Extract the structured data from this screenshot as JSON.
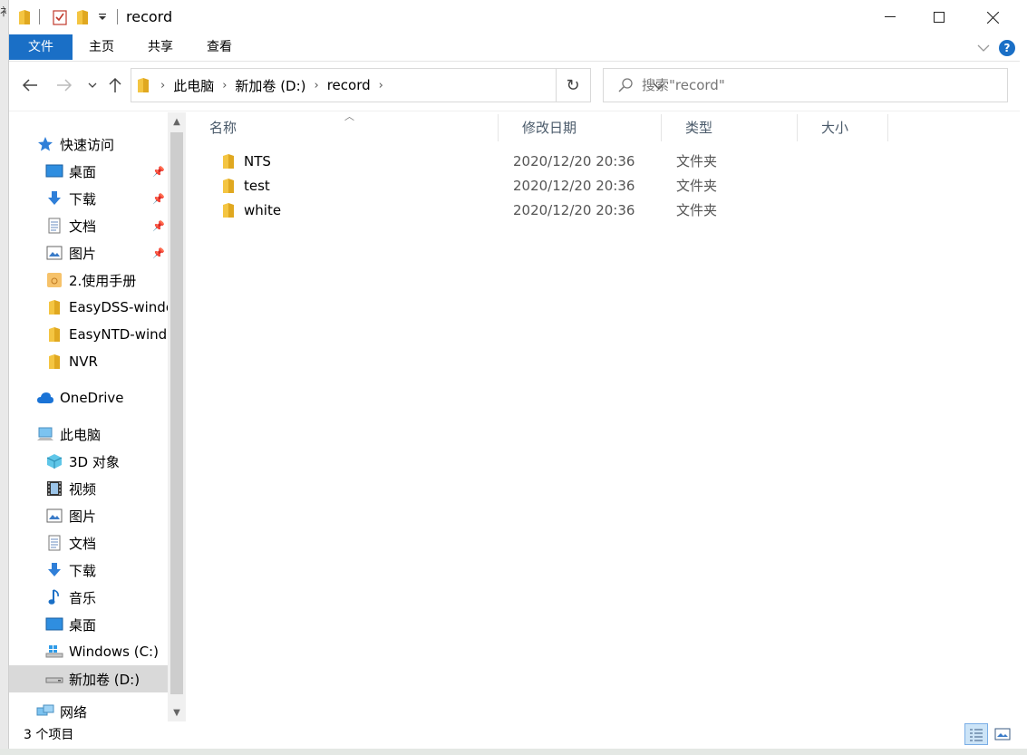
{
  "window": {
    "title": "record",
    "left_edge_text": "衤"
  },
  "ribbon": {
    "tabs": [
      {
        "label": "文件"
      },
      {
        "label": "主页"
      },
      {
        "label": "共享"
      },
      {
        "label": "查看"
      }
    ],
    "help": "?"
  },
  "address": {
    "crumbs": [
      "此电脑",
      "新加卷 (D:)",
      "record"
    ]
  },
  "search": {
    "placeholder": "搜索\"record\""
  },
  "nav": {
    "quick_access": "快速访问",
    "quick_items": [
      {
        "label": "桌面",
        "icon": "desktop-icon"
      },
      {
        "label": "下载",
        "icon": "download-icon"
      },
      {
        "label": "文档",
        "icon": "document-icon"
      },
      {
        "label": "图片",
        "icon": "picture-icon"
      },
      {
        "label": "2.使用手册",
        "icon": "folder-icon"
      },
      {
        "label": "EasyDSS-windo",
        "icon": "folder-icon"
      },
      {
        "label": "EasyNTD-windo",
        "icon": "folder-icon"
      },
      {
        "label": "NVR",
        "icon": "folder-icon"
      }
    ],
    "onedrive": "OneDrive",
    "this_pc": "此电脑",
    "pc_items": [
      {
        "label": "3D 对象",
        "icon": "3d-objects-icon"
      },
      {
        "label": "视频",
        "icon": "video-icon"
      },
      {
        "label": "图片",
        "icon": "picture-icon"
      },
      {
        "label": "文档",
        "icon": "document-icon"
      },
      {
        "label": "下载",
        "icon": "download-icon"
      },
      {
        "label": "音乐",
        "icon": "music-icon"
      },
      {
        "label": "桌面",
        "icon": "desktop-icon"
      },
      {
        "label": "Windows (C:)",
        "icon": "drive-c-icon"
      },
      {
        "label": "新加卷 (D:)",
        "icon": "drive-d-icon",
        "selected": true
      }
    ],
    "network": "网络"
  },
  "columns": [
    {
      "label": "名称"
    },
    {
      "label": "修改日期"
    },
    {
      "label": "类型"
    },
    {
      "label": "大小"
    }
  ],
  "files": [
    {
      "name": "NTS",
      "date": "2020/12/20 20:36",
      "type": "文件夹"
    },
    {
      "name": "test",
      "date": "2020/12/20 20:36",
      "type": "文件夹"
    },
    {
      "name": "white",
      "date": "2020/12/20 20:36",
      "type": "文件夹"
    }
  ],
  "status": {
    "item_count": "3 个项目"
  },
  "colors": {
    "accent": "#1a6fc6",
    "folder": "#f4c542",
    "selected_bg": "#d9d9d9"
  }
}
